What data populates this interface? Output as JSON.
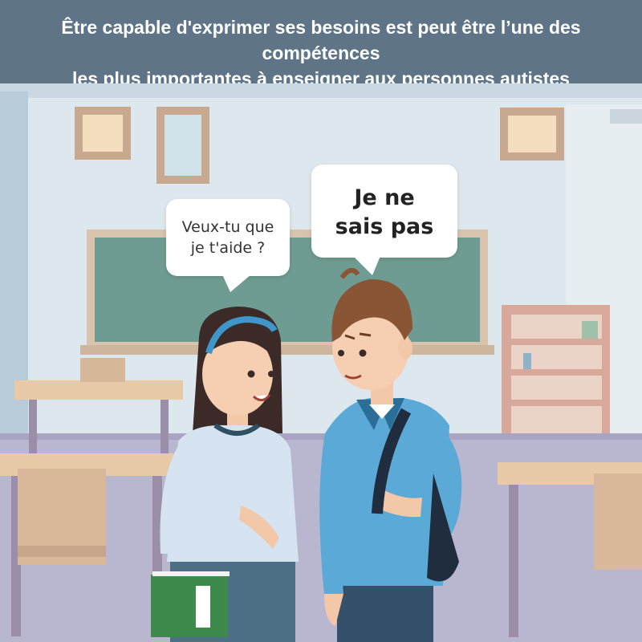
{
  "banner": {
    "line1": "Être capable d'exprimer ses besoins est peut être l’une des compétences",
    "line2": "les plus importantes à enseigner aux personnes autistes"
  },
  "dialogue": {
    "girl_line1": "Veux-tu que",
    "girl_line2": "je t'aide ?",
    "boy_line1": "Je ne",
    "boy_line2": "sais pas"
  },
  "colors": {
    "banner": "#5f7486",
    "wall": "#dfe9ef",
    "chalkboard": "#6f9c92",
    "floor": "#b7b4cf",
    "shirt_girl": "#d6e4f1",
    "shirt_boy": "#5aa9d6",
    "book": "#3e8a4d"
  }
}
